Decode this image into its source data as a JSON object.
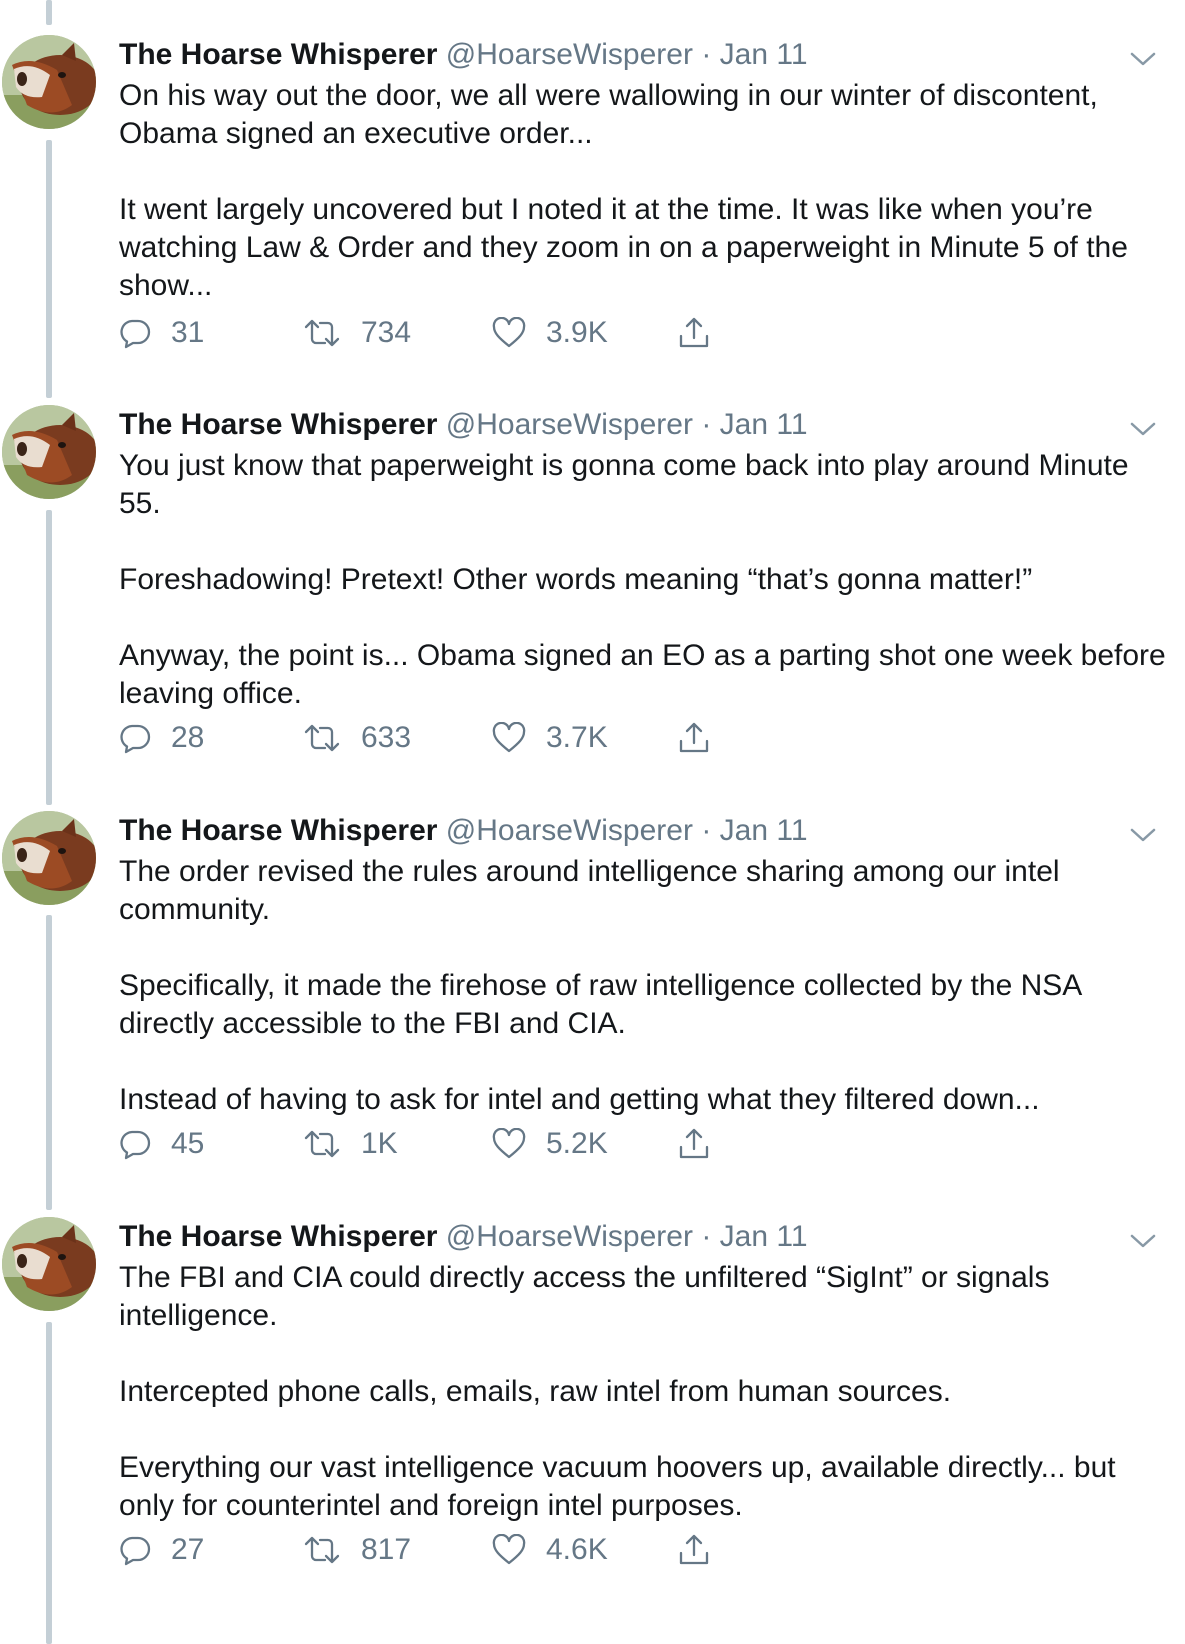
{
  "tweets": [
    {
      "name": "The Hoarse Whisperer",
      "handle": "@HoarseWisperer",
      "separator": "·",
      "date": "Jan 11",
      "paragraphs": [
        "On his way out the door, we all were wallowing in our winter of discontent, Obama signed an executive order...",
        "It went largely uncovered but I noted it at the time. It was like when you’re watching Law & Order and they zoom in on a paperweight in Minute 5 of the show..."
      ],
      "replies": "31",
      "retweets": "734",
      "likes": "3.9K"
    },
    {
      "name": "The Hoarse Whisperer",
      "handle": "@HoarseWisperer",
      "separator": "·",
      "date": "Jan 11",
      "paragraphs": [
        "You just know that paperweight is gonna come back into play around Minute 55.",
        "Foreshadowing! Pretext! Other words meaning “that’s gonna matter!”",
        "Anyway, the point is... Obama signed an EO as a parting shot one week before leaving office."
      ],
      "replies": "28",
      "retweets": "633",
      "likes": "3.7K"
    },
    {
      "name": "The Hoarse Whisperer",
      "handle": "@HoarseWisperer",
      "separator": "·",
      "date": "Jan 11",
      "paragraphs": [
        "The order revised the rules around intelligence sharing among our intel community.",
        "Specifically, it made the firehose of raw intelligence collected by the NSA directly accessible to the FBI and CIA.",
        "Instead of having to ask for intel and getting what they filtered down..."
      ],
      "replies": "45",
      "retweets": "1K",
      "likes": "5.2K"
    },
    {
      "name": "The Hoarse Whisperer",
      "handle": "@HoarseWisperer",
      "separator": "·",
      "date": "Jan 11",
      "paragraphs": [
        "The FBI and CIA could directly access the unfiltered “SigInt” or signals intelligence.",
        "Intercepted phone calls, emails, raw intel from human sources.",
        "Everything our vast intelligence vacuum hoovers up, available directly... but only for counterintel and foreign intel purposes."
      ],
      "replies": "27",
      "retweets": "817",
      "likes": "4.6K"
    }
  ],
  "icons": {
    "reply": "reply-icon",
    "retweet": "retweet-icon",
    "like": "heart-icon",
    "share": "share-icon",
    "menu": "chevron-down-icon"
  },
  "colors": {
    "text": "#14171a",
    "secondary": "#657786",
    "thread_line": "#c4cfd6"
  }
}
